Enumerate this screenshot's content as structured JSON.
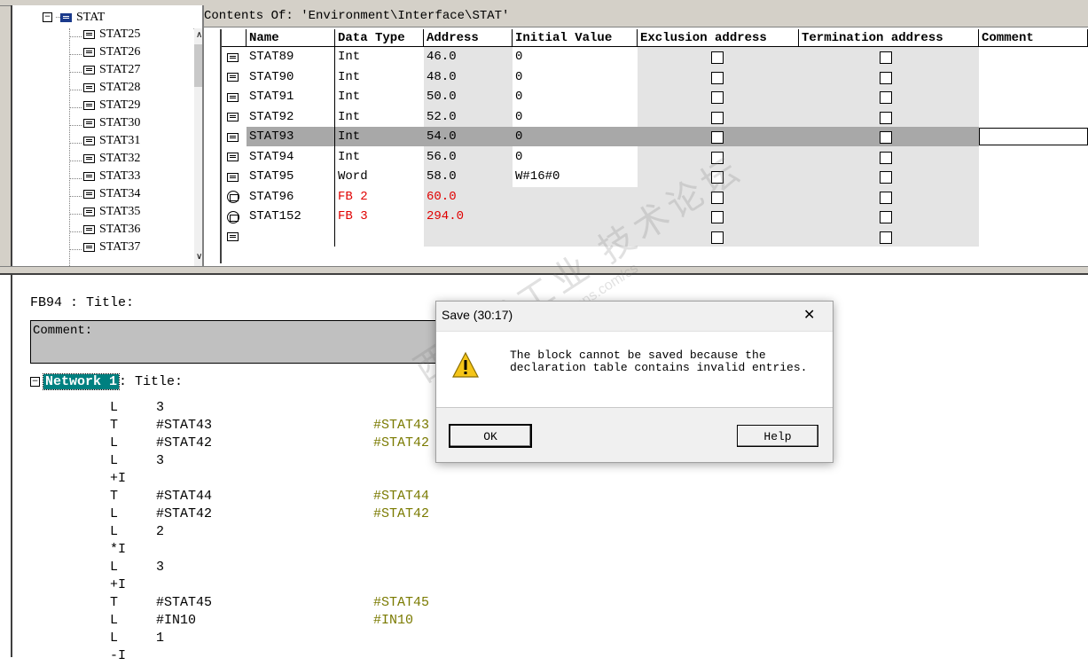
{
  "contents_of": "Contents Of: 'Environment\\Interface\\STAT'",
  "tree": {
    "root_label": "STAT",
    "items": [
      "STAT25",
      "STAT26",
      "STAT27",
      "STAT28",
      "STAT29",
      "STAT30",
      "STAT31",
      "STAT32",
      "STAT33",
      "STAT34",
      "STAT35",
      "STAT36",
      "STAT37"
    ]
  },
  "table": {
    "headers": [
      "Name",
      "Data Type",
      "Address",
      "Initial Value",
      "Exclusion address",
      "Termination address",
      "Comment"
    ],
    "rows": [
      {
        "name": "STAT89",
        "type": "Int",
        "address": "46.0",
        "init": "0",
        "icon": "var",
        "fb": false
      },
      {
        "name": "STAT90",
        "type": "Int",
        "address": "48.0",
        "init": "0",
        "icon": "var",
        "fb": false
      },
      {
        "name": "STAT91",
        "type": "Int",
        "address": "50.0",
        "init": "0",
        "icon": "var",
        "fb": false
      },
      {
        "name": "STAT92",
        "type": "Int",
        "address": "52.0",
        "init": "0",
        "icon": "var",
        "fb": false
      },
      {
        "name": "STAT93",
        "type": "Int",
        "address": "54.0",
        "init": "0",
        "icon": "var",
        "fb": false,
        "selected": true
      },
      {
        "name": "STAT94",
        "type": "Int",
        "address": "56.0",
        "init": "0",
        "icon": "var",
        "fb": false
      },
      {
        "name": "STAT95",
        "type": "Word",
        "address": "58.0",
        "init": "W#16#0",
        "icon": "var",
        "fb": false
      },
      {
        "name": "STAT96",
        "type": "FB 2",
        "address": "60.0",
        "init": "",
        "icon": "fb",
        "fb": true
      },
      {
        "name": "STAT152",
        "type": "FB 3",
        "address": "294.0",
        "init": "",
        "icon": "fb",
        "fb": true
      },
      {
        "name": "",
        "type": "",
        "address": "",
        "init": "",
        "icon": "empty",
        "fb": false
      }
    ],
    "error_color": "#e00000"
  },
  "editor": {
    "block_title": "FB94 : Title:",
    "comment_label": "Comment:",
    "network_label": "Network 1",
    "network_title": ": Title:",
    "code": [
      {
        "op": "L",
        "arg": "3",
        "sym": ""
      },
      {
        "op": "T",
        "arg": "#STAT43",
        "sym": "#STAT43"
      },
      {
        "op": "L",
        "arg": "#STAT42",
        "sym": "#STAT42"
      },
      {
        "op": "L",
        "arg": "3",
        "sym": ""
      },
      {
        "op": "+I",
        "arg": "",
        "sym": ""
      },
      {
        "op": "T",
        "arg": "#STAT44",
        "sym": "#STAT44"
      },
      {
        "op": "L",
        "arg": "#STAT42",
        "sym": "#STAT42"
      },
      {
        "op": "L",
        "arg": "2",
        "sym": ""
      },
      {
        "op": "*I",
        "arg": "",
        "sym": ""
      },
      {
        "op": "L",
        "arg": "3",
        "sym": ""
      },
      {
        "op": "+I",
        "arg": "",
        "sym": ""
      },
      {
        "op": "T",
        "arg": "#STAT45",
        "sym": "#STAT45"
      },
      {
        "op": "L",
        "arg": "#IN10",
        "sym": "#IN10"
      },
      {
        "op": "L",
        "arg": "1",
        "sym": ""
      },
      {
        "op": "-I",
        "arg": "",
        "sym": ""
      }
    ]
  },
  "dialog": {
    "title": "Save (30:17)",
    "close_glyph": "✕",
    "message_line1": "The block cannot be saved because the",
    "message_line2": "declaration table contains invalid entries.",
    "ok_label": "OK",
    "help_label": "Help",
    "icon": "warning-icon"
  },
  "watermark": {
    "cn": "西门子工业 技术论坛",
    "url": "support.industry.siemens.com/cs"
  }
}
